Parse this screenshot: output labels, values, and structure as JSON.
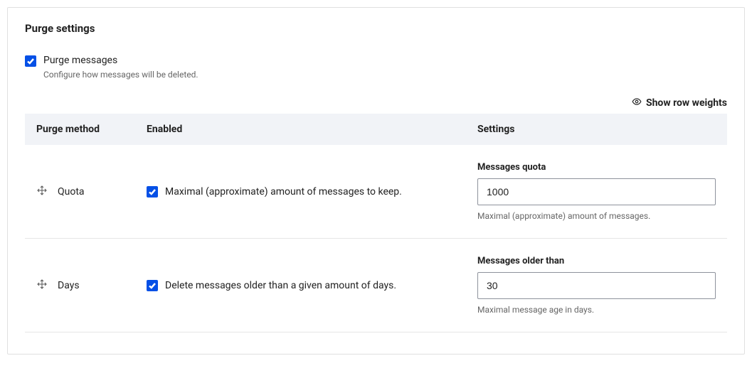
{
  "panel": {
    "title": "Purge settings"
  },
  "purge_messages": {
    "label": "Purge messages",
    "description": "Configure how messages will be deleted."
  },
  "show_row_weights": "Show row weights",
  "table": {
    "headers": {
      "method": "Purge method",
      "enabled": "Enabled",
      "settings": "Settings"
    },
    "rows": [
      {
        "method": "Quota",
        "enabled_label": "Maximal (approximate) amount of messages to keep.",
        "field_label": "Messages quota",
        "value": "1000",
        "help": "Maximal (approximate) amount of messages."
      },
      {
        "method": "Days",
        "enabled_label": "Delete messages older than a given amount of days.",
        "field_label": "Messages older than",
        "value": "30",
        "help": "Maximal message age in days."
      }
    ]
  }
}
